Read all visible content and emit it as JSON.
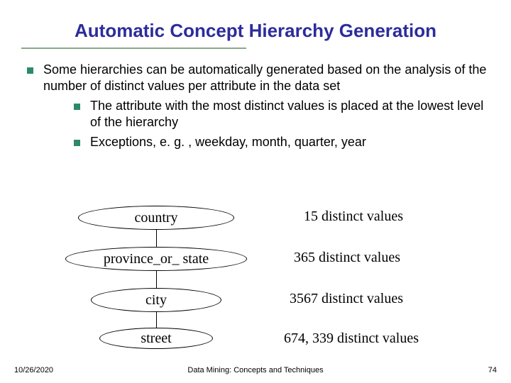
{
  "slide": {
    "title": "Automatic Concept Hierarchy Generation",
    "bullets": {
      "main": "Some hierarchies can be automatically generated based on the analysis of the number of distinct values per attribute in the data set",
      "sub1": "The attribute with the most distinct values is placed at the lowest level of the hierarchy",
      "sub2": "Exceptions, e. g. , weekday, month, quarter, year"
    },
    "hierarchy": [
      {
        "label": "country",
        "value": "15 distinct values"
      },
      {
        "label": "province_or_ state",
        "value": "365 distinct values"
      },
      {
        "label": "city",
        "value": "3567 distinct values"
      },
      {
        "label": "street",
        "value": "674, 339 distinct values"
      }
    ]
  },
  "footer": {
    "date": "10/26/2020",
    "caption": "Data Mining: Concepts and Techniques",
    "page": "74"
  }
}
